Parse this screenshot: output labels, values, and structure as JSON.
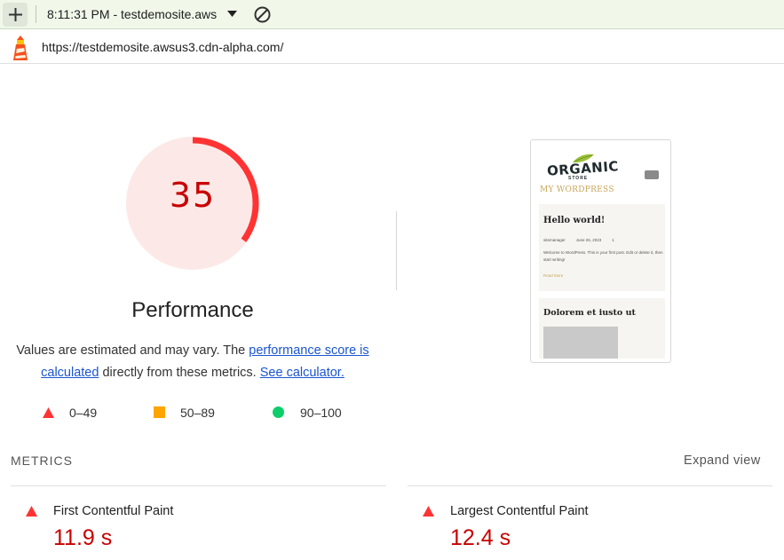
{
  "toolbar": {
    "new_report_icon": "plus-icon",
    "report_selector": "8:11:31 PM - testdemosite.aws",
    "dropdown_icon": "caret-down-icon",
    "clear_icon": "block-icon"
  },
  "urlbar": {
    "logo_icon": "lighthouse-icon",
    "url": "https://testdemosite.awsus3.cdn-alpha.com/"
  },
  "gauge": {
    "score": "35",
    "score_fraction": 0.35,
    "color_fail": "#ff3333",
    "background": "#fce9e7"
  },
  "category": {
    "title": "Performance",
    "desc_prefix": "Values are estimated and may vary. The ",
    "desc_link1": "performance score is calculated",
    "desc_middle": " directly from these metrics. ",
    "desc_link2": "See calculator."
  },
  "legend": {
    "fail": "0–49",
    "average": "50–89",
    "pass": "90–100",
    "color_average": "#ffa400",
    "color_pass": "#0cce6b"
  },
  "screenshot": {
    "logo": "ORGANIC",
    "logo_sub": "STORE",
    "site_title": "MY WORDPRESS",
    "post1_title": "Hello world!",
    "post1_author": "sitemanager",
    "post1_date": "June 26, 2023",
    "post1_comments": "1",
    "post1_excerpt": "Welcome to WordPress. This is your first post. Edit or delete it, then start writing!",
    "post1_read_more": "Read More",
    "post2_title": "Dolorem et iusto ut"
  },
  "metrics": {
    "header": "METRICS",
    "expand": "Expand view",
    "items": [
      {
        "name": "First Contentful Paint",
        "value": "11.9 s"
      },
      {
        "name": "Largest Contentful Paint",
        "value": "12.4 s"
      }
    ]
  }
}
